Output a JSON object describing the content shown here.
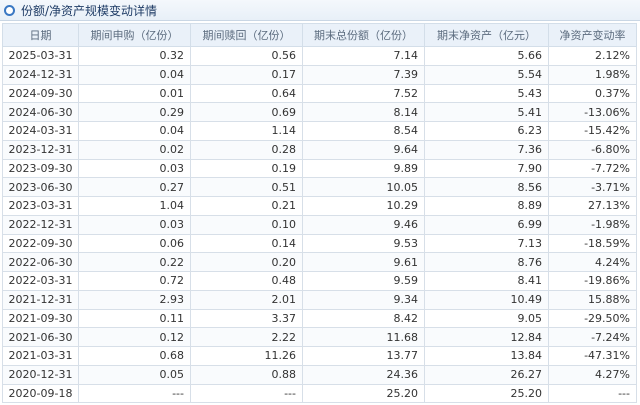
{
  "title": "份额/净资产规模变动详情",
  "columns": [
    "日期",
    "期间申购（亿份）",
    "期间赎回（亿份）",
    "期末总份额（亿份）",
    "期末净资产（亿元）",
    "净资产变动率"
  ],
  "rows": [
    [
      "2025-03-31",
      "0.32",
      "0.56",
      "7.14",
      "5.66",
      "2.12%"
    ],
    [
      "2024-12-31",
      "0.04",
      "0.17",
      "7.39",
      "5.54",
      "1.98%"
    ],
    [
      "2024-09-30",
      "0.01",
      "0.64",
      "7.52",
      "5.43",
      "0.37%"
    ],
    [
      "2024-06-30",
      "0.29",
      "0.69",
      "8.14",
      "5.41",
      "-13.06%"
    ],
    [
      "2024-03-31",
      "0.04",
      "1.14",
      "8.54",
      "6.23",
      "-15.42%"
    ],
    [
      "2023-12-31",
      "0.02",
      "0.28",
      "9.64",
      "7.36",
      "-6.80%"
    ],
    [
      "2023-09-30",
      "0.03",
      "0.19",
      "9.89",
      "7.90",
      "-7.72%"
    ],
    [
      "2023-06-30",
      "0.27",
      "0.51",
      "10.05",
      "8.56",
      "-3.71%"
    ],
    [
      "2023-03-31",
      "1.04",
      "0.21",
      "10.29",
      "8.89",
      "27.13%"
    ],
    [
      "2022-12-31",
      "0.03",
      "0.10",
      "9.46",
      "6.99",
      "-1.98%"
    ],
    [
      "2022-09-30",
      "0.06",
      "0.14",
      "9.53",
      "7.13",
      "-18.59%"
    ],
    [
      "2022-06-30",
      "0.22",
      "0.20",
      "9.61",
      "8.76",
      "4.24%"
    ],
    [
      "2022-03-31",
      "0.72",
      "0.48",
      "9.59",
      "8.41",
      "-19.86%"
    ],
    [
      "2021-12-31",
      "2.93",
      "2.01",
      "9.34",
      "10.49",
      "15.88%"
    ],
    [
      "2021-09-30",
      "0.11",
      "3.37",
      "8.42",
      "9.05",
      "-29.50%"
    ],
    [
      "2021-06-30",
      "0.12",
      "2.22",
      "11.68",
      "12.84",
      "-7.24%"
    ],
    [
      "2021-03-31",
      "0.68",
      "11.26",
      "13.77",
      "13.84",
      "-47.31%"
    ],
    [
      "2020-12-31",
      "0.05",
      "0.88",
      "24.36",
      "26.27",
      "4.27%"
    ],
    [
      "2020-09-18",
      "---",
      "---",
      "25.20",
      "25.20",
      "---"
    ]
  ]
}
